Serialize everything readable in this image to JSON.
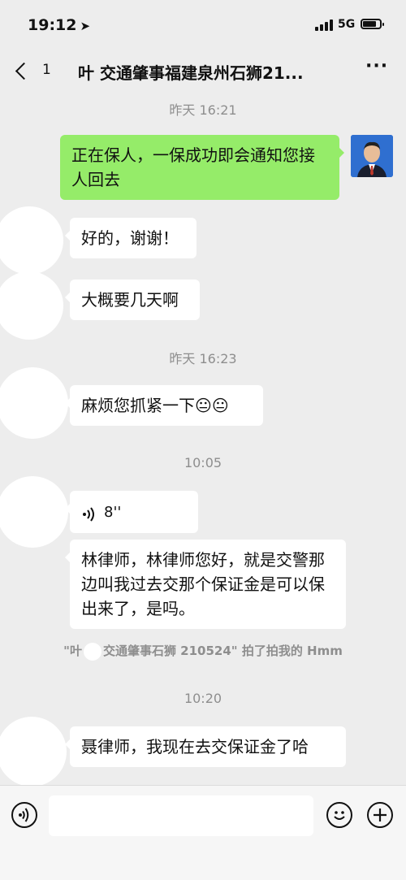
{
  "status": {
    "time": "19:12",
    "network": "5G"
  },
  "nav": {
    "back_count": "1",
    "title": "叶  交通肇事福建泉州石狮21..."
  },
  "messages": [
    {
      "type": "time",
      "text": "昨天 16:21"
    },
    {
      "type": "out",
      "text": "正在保人，一保成功即会通知您接人回去"
    },
    {
      "type": "in",
      "text": "好的，谢谢！"
    },
    {
      "type": "in",
      "text": "大概要几天啊"
    },
    {
      "type": "time",
      "text": "昨天 16:23"
    },
    {
      "type": "in",
      "text": "麻烦您抓紧一下"
    },
    {
      "type": "time",
      "text": "10:05"
    },
    {
      "type": "voice",
      "duration": "8''"
    },
    {
      "type": "in",
      "text": "林律师，林律师您好，就是交警那边叫我过去交那个保证金是可以保出来了，是吗。"
    },
    {
      "type": "system",
      "pre": "\"叶",
      "post": "交通肇事石狮 210524\" 拍了拍我的 Hmm"
    },
    {
      "type": "time",
      "text": "10:20"
    },
    {
      "type": "in",
      "text": "聂律师，我现在去交保证金了哈"
    }
  ],
  "emoji": [
    "😐",
    "😐"
  ],
  "input": {
    "placeholder": ""
  },
  "icons": {
    "back": "chevron-left-icon",
    "more": "ellipsis-icon",
    "voice_toggle": "voice-icon",
    "emoji": "emoji-icon",
    "add": "plus-icon"
  },
  "colors": {
    "bg": "#ededed",
    "out_bubble": "#95ec69",
    "in_bubble": "#ffffff",
    "meta": "#8e8e8e"
  }
}
